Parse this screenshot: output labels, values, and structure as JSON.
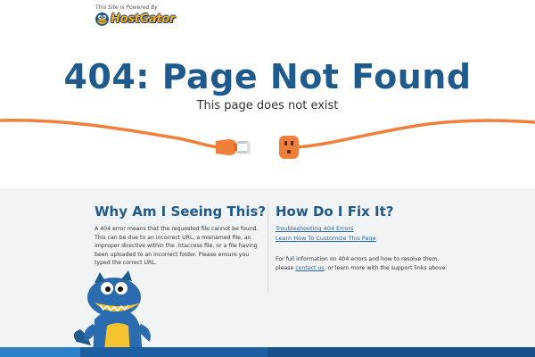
{
  "header": {
    "powered_by": "This Site Is Powered By",
    "brand": "HostGator",
    "logo_icon": "gator-head-icon"
  },
  "hero": {
    "title": "404: Page Not Found",
    "subtitle": "This page does not exist",
    "illustration": "unplugged-cord-icon"
  },
  "why": {
    "heading": "Why Am I Seeing This?",
    "body": "A 404 error means that the requested file cannot be found. This can be due to an incorrect URL, a misnamed file, an improper directive within the .htaccess file, or a file having been uploaded to an incorrect folder. Please ensure you typed the correct URL."
  },
  "fix": {
    "heading": "How Do I Fix It?",
    "links": [
      "Troubleshooting 404 Errors",
      "Learn How To Customize This Page"
    ],
    "text_before": "For full information on 404 errors and how to resolve them, please ",
    "contact_label": "contact us",
    "text_after": ", or learn more with the support links above."
  },
  "colors": {
    "brand_blue": "#1f5a8c",
    "cord_orange": "#f07f3c",
    "link_blue": "#1f67a8",
    "band_gray": "#f2f3f4"
  },
  "mascot": "gator-mascot-icon"
}
